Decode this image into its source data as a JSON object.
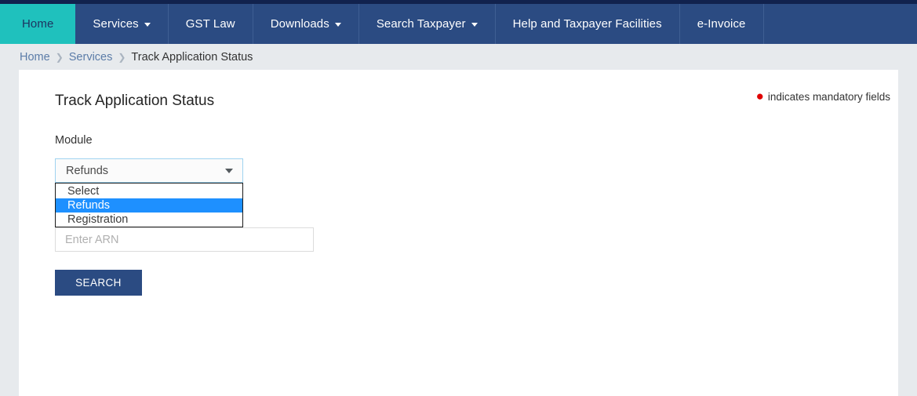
{
  "navbar": {
    "items": [
      {
        "label": "Home",
        "active": true,
        "has_caret": false
      },
      {
        "label": "Services",
        "active": false,
        "has_caret": true
      },
      {
        "label": "GST Law",
        "active": false,
        "has_caret": false
      },
      {
        "label": "Downloads",
        "active": false,
        "has_caret": true
      },
      {
        "label": "Search Taxpayer",
        "active": false,
        "has_caret": true
      },
      {
        "label": "Help and Taxpayer Facilities",
        "active": false,
        "has_caret": false
      },
      {
        "label": "e-Invoice",
        "active": false,
        "has_caret": false
      }
    ],
    "active_bg": "#1fc1bd",
    "bg": "#2b4b82",
    "top_strip": "#11224e"
  },
  "breadcrumb": {
    "items": [
      {
        "label": "Home",
        "current": false
      },
      {
        "label": "Services",
        "current": false
      },
      {
        "label": "Track Application Status",
        "current": true
      }
    ],
    "separator": "❯"
  },
  "page": {
    "title": "Track Application Status",
    "mandatory_note": "indicates mandatory fields",
    "mandatory_dot_color": "#e00000"
  },
  "form": {
    "module": {
      "label": "Module",
      "selected": "Refunds",
      "options": [
        {
          "label": "Select",
          "selected": false
        },
        {
          "label": "Refunds",
          "selected": true
        },
        {
          "label": "Registration",
          "selected": false
        }
      ],
      "open": true,
      "highlight_color": "#1e90ff"
    },
    "arn": {
      "value": "",
      "placeholder": "Enter ARN"
    },
    "search_button": {
      "label": "SEARCH",
      "color": "#2b4b82"
    }
  }
}
